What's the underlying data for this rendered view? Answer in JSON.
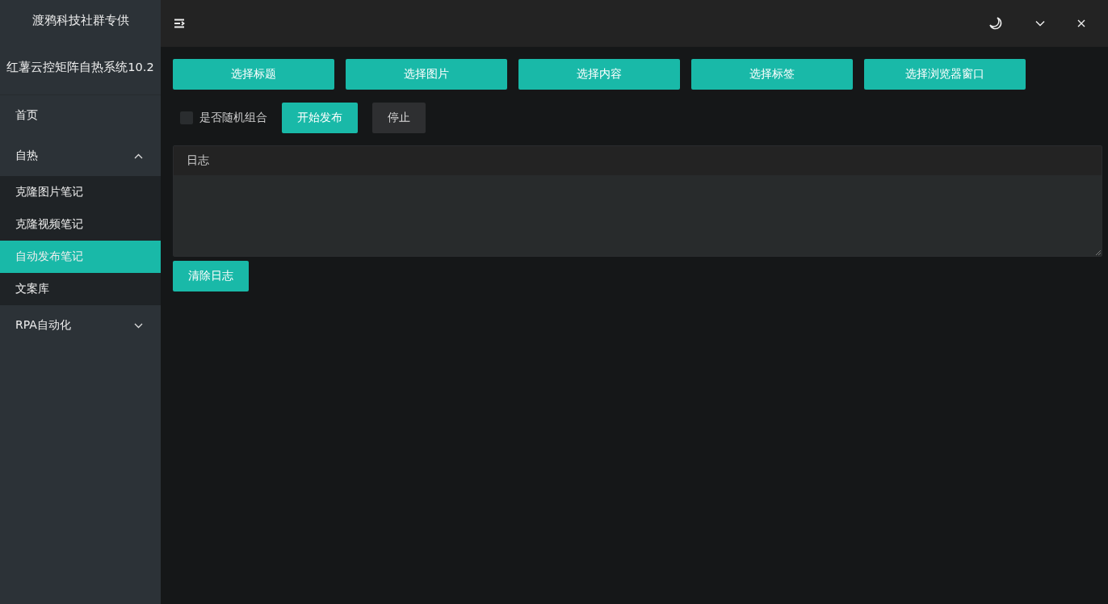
{
  "sidebar": {
    "brand": "渡鸦科技社群专供",
    "title": "红薯云控矩阵自热系统10.2",
    "menu": [
      {
        "label": "首页",
        "selected": false
      },
      {
        "label": "自热",
        "expanded": true,
        "children": [
          {
            "label": "克隆图片笔记",
            "selected": false
          },
          {
            "label": "克隆视频笔记",
            "selected": false
          },
          {
            "label": "自动发布笔记",
            "selected": true
          },
          {
            "label": "文案库",
            "selected": false
          }
        ]
      },
      {
        "label": "RPA自动化",
        "expanded": false
      }
    ]
  },
  "toolbar": {
    "buttons": [
      "选择标题",
      "选择图片",
      "选择内容",
      "选择标签",
      "选择浏览器窗口"
    ]
  },
  "controls": {
    "checkbox": {
      "label": "是否随机组合",
      "checked": false
    },
    "buttons": [
      {
        "label": "开始发布",
        "kind": "primary"
      },
      {
        "label": "停止",
        "kind": "default"
      }
    ]
  },
  "log": {
    "title": "日志",
    "clear_button": "清除日志"
  }
}
